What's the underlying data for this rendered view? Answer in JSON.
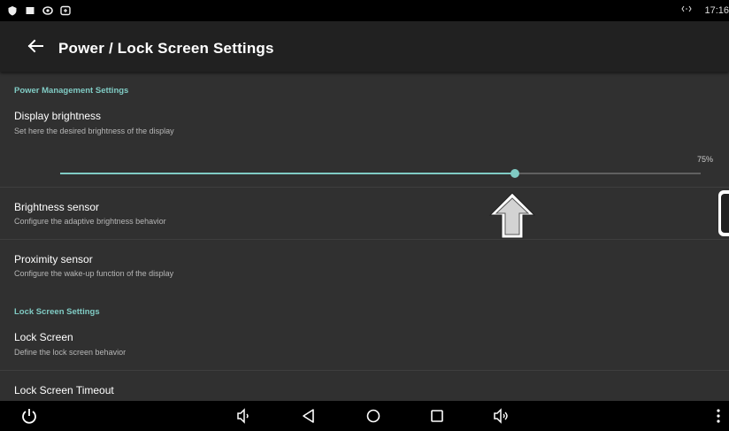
{
  "status_bar": {
    "time": "17:16",
    "icons": [
      "shield-icon",
      "square-icon",
      "eye-icon",
      "app-icon",
      "data-transfer-icon"
    ]
  },
  "app_bar": {
    "title": "Power / Lock Screen Settings",
    "back_icon": "arrow-back-icon"
  },
  "sections": {
    "power": {
      "header": "Power Management Settings"
    },
    "lock": {
      "header": "Lock Screen Settings"
    }
  },
  "items": {
    "display_brightness": {
      "title": "Display brightness",
      "subtitle": "Set here the desired brightness of the display",
      "value_label": "75%",
      "value": 0.71
    },
    "brightness_sensor": {
      "title": "Brightness sensor",
      "subtitle": "Configure the adaptive brightness behavior"
    },
    "proximity_sensor": {
      "title": "Proximity sensor",
      "subtitle": "Configure the wake-up function of the display"
    },
    "lock_screen": {
      "title": "Lock Screen",
      "subtitle": "Define the lock screen behavior"
    },
    "lock_screen_timeout": {
      "title": "Lock Screen Timeout"
    }
  },
  "nav_bar": {
    "icons": [
      "power-icon",
      "volume-down-icon",
      "back-triangle-icon",
      "home-circle-icon",
      "recents-square-icon",
      "volume-up-icon",
      "more-vert-icon"
    ]
  },
  "colors": {
    "accent": "#80cbc4",
    "background": "#303030",
    "app_bar": "#212121"
  }
}
